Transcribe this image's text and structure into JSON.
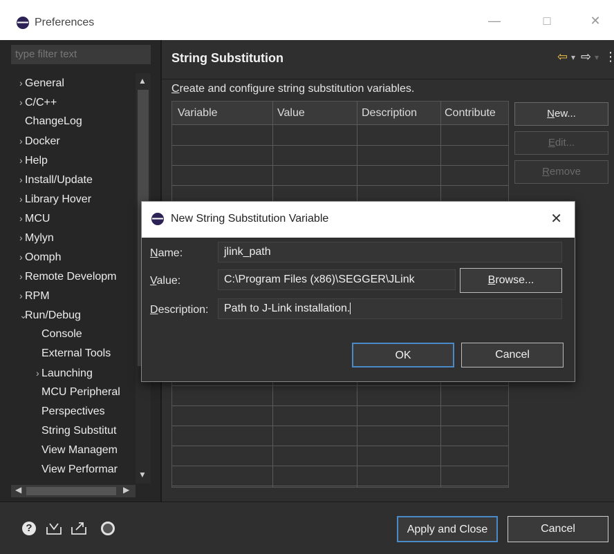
{
  "window": {
    "title": "Preferences",
    "minimize_glyph": "—",
    "maximize_glyph": "□",
    "close_glyph": "✕"
  },
  "filter": {
    "placeholder": "type filter text"
  },
  "tree": {
    "items": [
      {
        "label": "General",
        "expander": "›",
        "level": 0
      },
      {
        "label": "C/C++",
        "expander": "›",
        "level": 0
      },
      {
        "label": "ChangeLog",
        "expander": "",
        "level": 0
      },
      {
        "label": "Docker",
        "expander": "›",
        "level": 0
      },
      {
        "label": "Help",
        "expander": "›",
        "level": 0
      },
      {
        "label": "Install/Update",
        "expander": "›",
        "level": 0
      },
      {
        "label": "Library Hover",
        "expander": "›",
        "level": 0
      },
      {
        "label": "MCU",
        "expander": "›",
        "level": 0
      },
      {
        "label": "Mylyn",
        "expander": "›",
        "level": 0
      },
      {
        "label": "Oomph",
        "expander": "›",
        "level": 0
      },
      {
        "label": "Remote Developm",
        "expander": "›",
        "level": 0
      },
      {
        "label": "RPM",
        "expander": "›",
        "level": 0
      },
      {
        "label": "Run/Debug",
        "expander": "⌄",
        "level": 0
      },
      {
        "label": "Console",
        "expander": "",
        "level": 1
      },
      {
        "label": "External Tools",
        "expander": "",
        "level": 1
      },
      {
        "label": "Launching",
        "expander": "›",
        "level": 1
      },
      {
        "label": "MCU Peripheral",
        "expander": "",
        "level": 1
      },
      {
        "label": "Perspectives",
        "expander": "",
        "level": 1
      },
      {
        "label": "String Substitut",
        "expander": "",
        "level": 1
      },
      {
        "label": "View Managem",
        "expander": "",
        "level": 1
      },
      {
        "label": "View Performar",
        "expander": "",
        "level": 1
      }
    ]
  },
  "page": {
    "title": "String Substitution",
    "description_prefix": "C",
    "description_rest": "reate and configure string substitution variables.",
    "nav_back": "⇦",
    "nav_forward": "⇨",
    "nav_dropdown": "▾",
    "menu": "⋮",
    "table": {
      "columns": [
        "Variable",
        "Value",
        "Description",
        "Contribute"
      ],
      "rows": []
    },
    "buttons": {
      "new_prefix": "N",
      "new_rest": "ew...",
      "edit_prefix": "E",
      "edit_rest": "dit...",
      "remove_prefix": "R",
      "remove_rest": "emove"
    }
  },
  "dialog": {
    "title": "New String Substitution Variable",
    "close_glyph": "✕",
    "name_label_prefix": "N",
    "name_label_rest": "ame:",
    "name_value": "jlink_path",
    "value_label_prefix": "V",
    "value_label_rest": "alue:",
    "value_value": "C:\\Program Files (x86)\\SEGGER\\JLink",
    "browse_prefix": "B",
    "browse_rest": "rowse...",
    "description_label_prefix": "D",
    "description_label_rest": "escription:",
    "description_value": "Path to J-Link installation.",
    "ok_label": "OK",
    "cancel_label": "Cancel"
  },
  "bottom": {
    "help_icon": "?",
    "apply_close_label": "Apply and Close",
    "cancel_label": "Cancel"
  }
}
